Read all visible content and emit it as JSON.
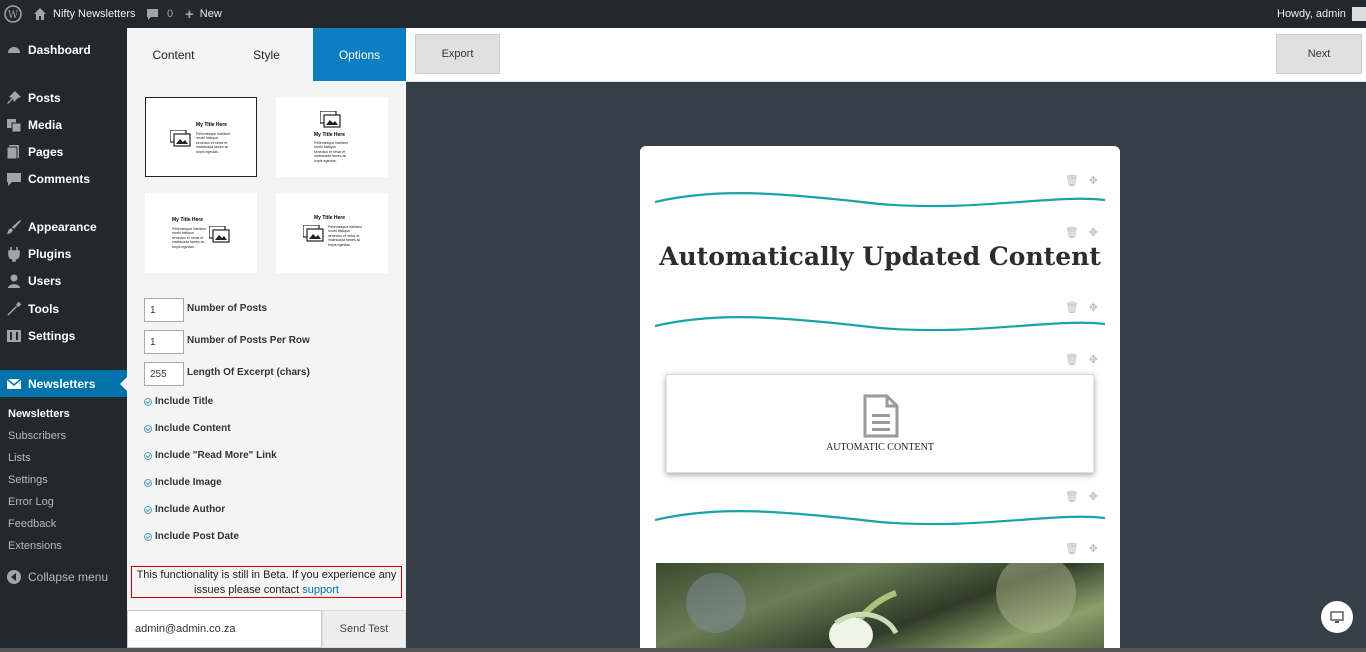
{
  "adminbar": {
    "site_name": "Nifty Newsletters",
    "comments_count": "0",
    "new_label": "New",
    "howdy": "Howdy, admin"
  },
  "sidebar": {
    "items": [
      {
        "label": "Dashboard",
        "icon": "dashboard-icon"
      },
      {
        "label": "Posts",
        "icon": "pin-icon"
      },
      {
        "label": "Media",
        "icon": "media-icon"
      },
      {
        "label": "Pages",
        "icon": "pages-icon"
      },
      {
        "label": "Comments",
        "icon": "comment-icon"
      },
      {
        "label": "Appearance",
        "icon": "brush-icon"
      },
      {
        "label": "Plugins",
        "icon": "plug-icon"
      },
      {
        "label": "Users",
        "icon": "user-icon"
      },
      {
        "label": "Tools",
        "icon": "wrench-icon"
      },
      {
        "label": "Settings",
        "icon": "settings-icon"
      },
      {
        "label": "Newsletters",
        "icon": "mail-icon"
      }
    ],
    "submenu": [
      "Newsletters",
      "Subscribers",
      "Lists",
      "Settings",
      "Error Log",
      "Feedback",
      "Extensions"
    ],
    "collapse": "Collapse menu"
  },
  "panel": {
    "tabs": [
      "Content",
      "Style",
      "Options"
    ],
    "layout_title": "My Title Here",
    "layout_text": "Pellentesque habitant morbi tristique senectus et netus et malesuada fames ac turpis egestas.",
    "fields": [
      {
        "value": "1",
        "label": "Number of Posts"
      },
      {
        "value": "1",
        "label": "Number of Posts Per Row"
      },
      {
        "value": "255",
        "label": "Length Of Excerpt (chars)"
      }
    ],
    "checks": [
      "Include Title",
      "Include Content",
      "Include \"Read More\" Link",
      "Include Image",
      "Include Author",
      "Include Post Date"
    ],
    "beta_text": "This functionality is still in Beta. If you experience any issues please contact",
    "beta_link": "support",
    "email_value": "admin@admin.co.za",
    "send_test": "Send Test"
  },
  "topbar": {
    "export": "Export",
    "next": "Next"
  },
  "newsletter": {
    "heading": "Automatically Updated Content",
    "auto_label": "AUTOMATIC CONTENT",
    "wave_color": "#17a3a8"
  }
}
